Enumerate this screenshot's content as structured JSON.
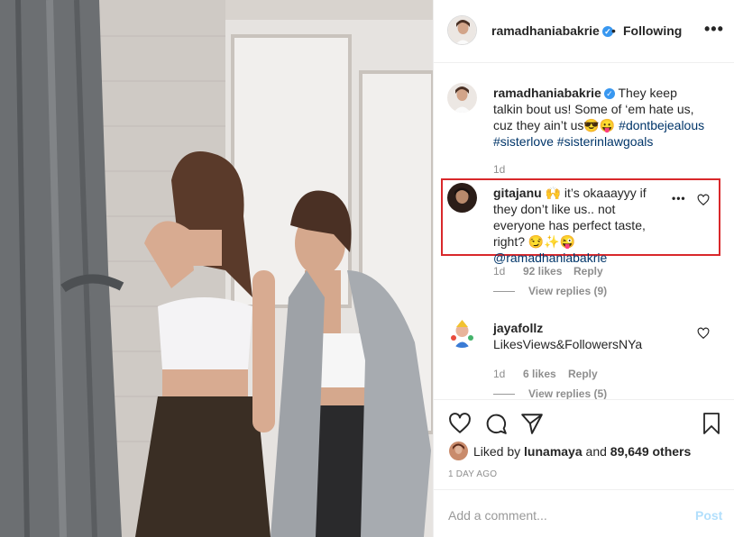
{
  "post": {
    "header": {
      "username": "ramadhaniabakrie",
      "verified_glyph": "✓",
      "separator": "•",
      "follow_status": "Following",
      "more_label": "•••"
    },
    "caption": {
      "username": "ramadhaniabakrie",
      "text": "They keep talkin bout us! Some of ‘em hate us, cuz they ain’t us",
      "emojis": "😎😛",
      "hashtags": "#dontbejealous #sisterlove #sisterinlawgoals",
      "age": "1d"
    },
    "comments": [
      {
        "username": "gitajanu",
        "emoji_lead": "🙌",
        "text": "it’s okaaayyy if they don’t like us.. not everyone has perfect taste, right?",
        "emoji_tail": "😏✨😜",
        "mention": "@ramadhaniabakrie",
        "age": "1d",
        "likes": "92 likes",
        "reply_label": "Reply",
        "view_replies": "View replies (9)",
        "more_label": "•••"
      },
      {
        "username": "jayafollz",
        "text": "LikesViews&FollowersNYa",
        "age": "1d",
        "likes": "6 likes",
        "reply_label": "Reply",
        "view_replies": "View replies (5)"
      }
    ],
    "liked_by": {
      "prefix": "Liked by",
      "user": "lunamaya",
      "connector": "and",
      "count": "89,649 others"
    },
    "timestamp": "1 DAY AGO",
    "add_comment": {
      "placeholder": "Add a comment...",
      "post_label": "Post"
    },
    "colors": {
      "highlight_border": "#d9282b",
      "link": "#003569",
      "verified": "#3897f0",
      "post_disabled": "#b2dffc"
    },
    "icons": [
      "heart-icon",
      "comment-icon",
      "share-icon",
      "bookmark-icon",
      "verified-icon",
      "more-icon"
    ]
  }
}
